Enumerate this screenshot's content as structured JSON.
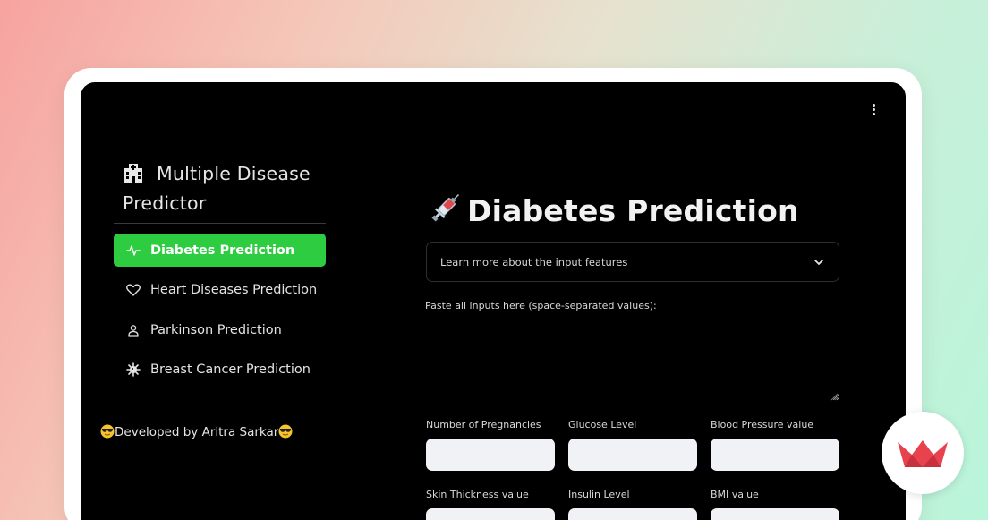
{
  "header": {
    "menu_icon": "vertical-ellipsis-icon"
  },
  "sidebar": {
    "title": "Multiple Disease Predictor",
    "title_icon": "hospital-icon",
    "items": [
      {
        "label": "Diabetes Prediction",
        "icon": "activity-icon",
        "active": true
      },
      {
        "label": "Heart Diseases Prediction",
        "icon": "heart-icon",
        "active": false
      },
      {
        "label": "Parkinson Prediction",
        "icon": "person-icon",
        "active": false
      },
      {
        "label": "Breast Cancer Prediction",
        "icon": "virus-icon",
        "active": false
      }
    ],
    "developer": "Developed by Aritra Sarkar",
    "developer_emoji": "sunglasses-emoji"
  },
  "main": {
    "title": "Diabetes Prediction",
    "title_icon": "syringe-icon",
    "expander_label": "Learn more about the input features",
    "paste_label": "Paste all inputs here (space-separated values):",
    "paste_value": "",
    "fields": [
      {
        "label": "Number of Pregnancies",
        "value": ""
      },
      {
        "label": "Glucose Level",
        "value": ""
      },
      {
        "label": "Blood Pressure value",
        "value": ""
      },
      {
        "label": "Skin Thickness value",
        "value": ""
      },
      {
        "label": "Insulin Level",
        "value": ""
      },
      {
        "label": "BMI value",
        "value": ""
      }
    ]
  },
  "colors": {
    "accent": "#2ecc40",
    "app_background": "#000000",
    "input_background": "#f0f2f6",
    "badge_crown": "#e8424f"
  },
  "badge": {
    "icon": "crown-icon"
  }
}
